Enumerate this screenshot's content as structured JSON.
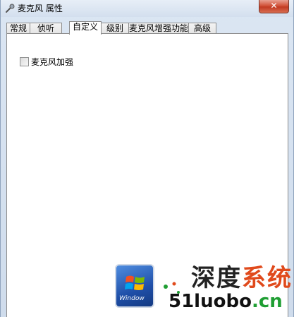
{
  "window": {
    "title": "麦克风 属性",
    "close_label": "✕"
  },
  "tabs": [
    {
      "label": "常规",
      "active": false
    },
    {
      "label": "侦听",
      "active": false
    },
    {
      "label": "自定义",
      "active": true
    },
    {
      "label": "级别",
      "active": false
    },
    {
      "label": "麦克风增强功能",
      "active": false
    },
    {
      "label": "高级",
      "active": false
    }
  ],
  "panel": {
    "checkbox_label": "麦克风加强",
    "checkbox_checked": false
  },
  "watermark": {
    "logo_text": "Window",
    "site_name_a": "深度",
    "site_name_b": "系统",
    "site_url_a": "51luobo",
    "site_url_b": ".cn"
  }
}
